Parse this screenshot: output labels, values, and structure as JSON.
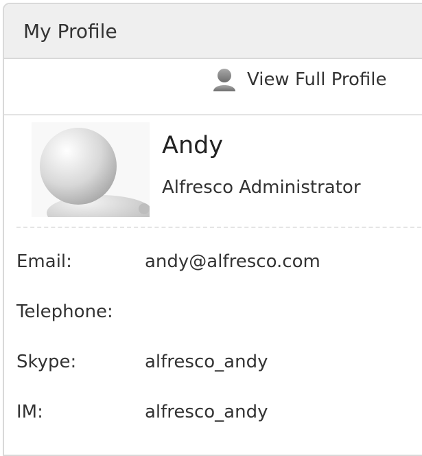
{
  "dashlet": {
    "title": "My Profile"
  },
  "toolbar": {
    "view_full_profile_label": "View Full Profile",
    "icon": "user-icon"
  },
  "profile": {
    "name": "Andy",
    "job_title": "Alfresco Administrator",
    "avatar_icon": "default-avatar-icon"
  },
  "fields": [
    {
      "label": "Email:",
      "value": "andy@alfresco.com"
    },
    {
      "label": "Telephone:",
      "value": ""
    },
    {
      "label": "Skype:",
      "value": "alfresco_andy"
    },
    {
      "label": "IM:",
      "value": "alfresco_andy"
    }
  ],
  "colors": {
    "title_bar_bg": "#efefef",
    "border": "#d9d9d9",
    "text": "#333333"
  }
}
